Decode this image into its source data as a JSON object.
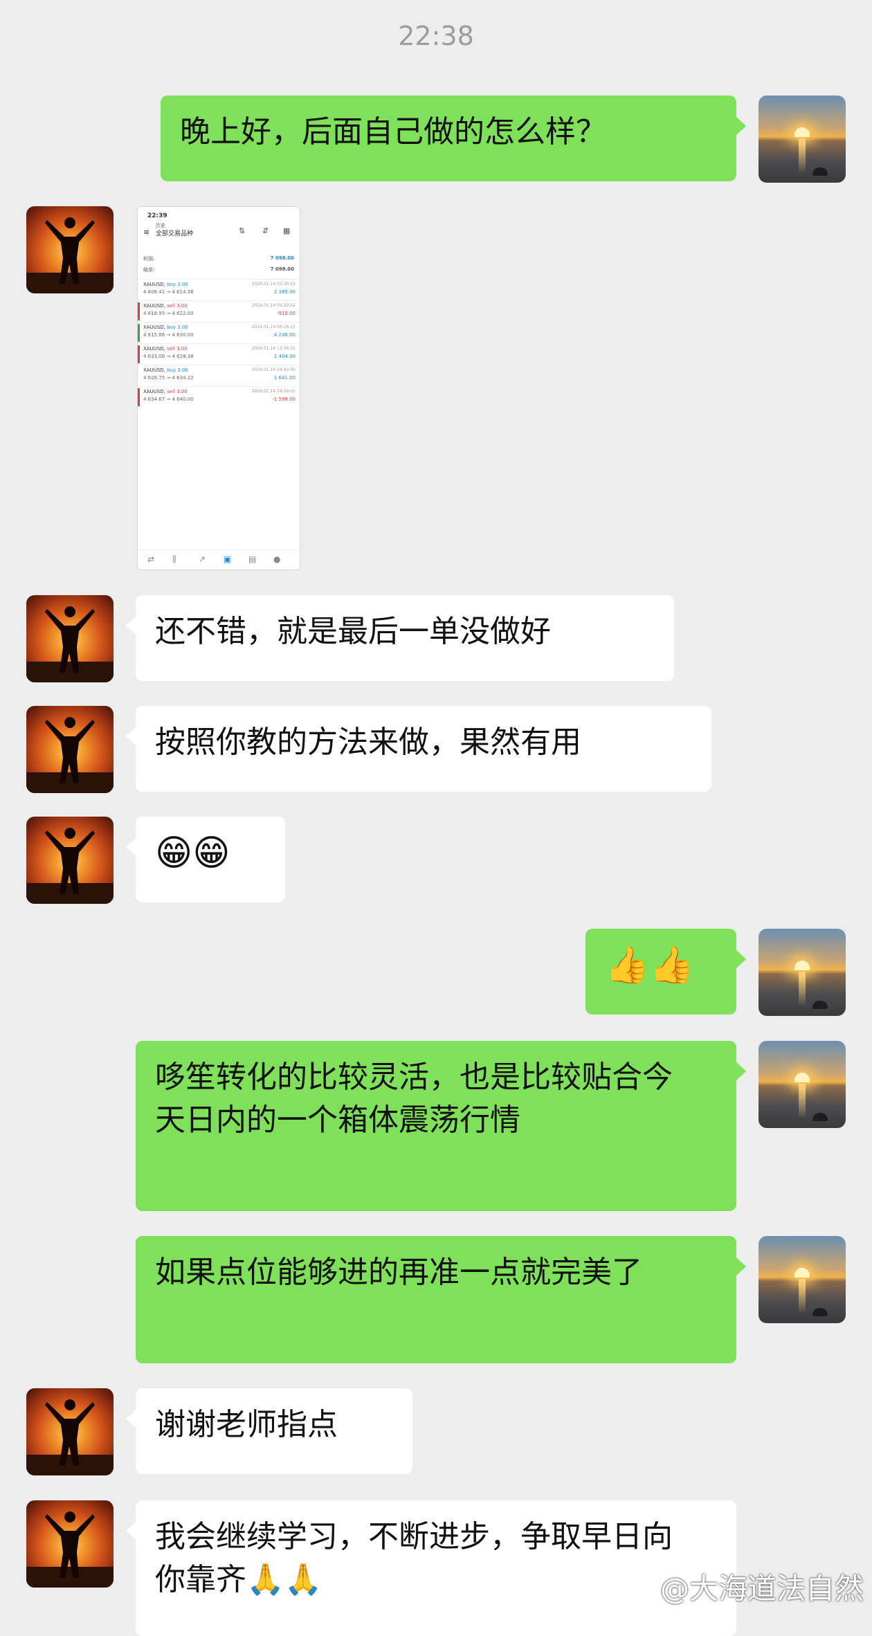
{
  "chat": {
    "time": "22:38",
    "messages": [
      {
        "from": "me",
        "text": "晚上好，后面自己做的怎么样？"
      },
      {
        "from": "friend",
        "type": "image"
      },
      {
        "from": "friend",
        "text": "还不错，就是最后一单没做好"
      },
      {
        "from": "friend",
        "text": "按照你教的方法来做，果然有用"
      },
      {
        "from": "friend",
        "text": "😁😁"
      },
      {
        "from": "me",
        "text": "👍👍"
      },
      {
        "from": "me",
        "text": "哆笙转化的比较灵活，也是比较贴合今天日内的一个箱体震荡行情"
      },
      {
        "from": "me",
        "text": "如果点位能够进的再准一点就完美了"
      },
      {
        "from": "friend",
        "text": "谢谢老师指点"
      },
      {
        "from": "friend",
        "text": "我会继续学习，不断进步，争取早日向你靠齐🙏🙏"
      }
    ]
  },
  "screenshot": {
    "status_time": "22:39",
    "header_small": "历史",
    "header_title": "全部交易品种",
    "profit_label": "利润:",
    "profit_value": "7 098.00",
    "balance_label": "结余:",
    "balance_value": "7 098.00",
    "trades": [
      {
        "symbol": "XAUUSD,",
        "side": "buy 3.00",
        "prices": "4 606.41 → 4 614.36",
        "datetime": "2026.01.14 03:30:51",
        "pl": "2 385.00",
        "dir": "buy"
      },
      {
        "symbol": "XAUUSD,",
        "side": "sell 3.00",
        "prices": "4 618.95 → 4 622.00",
        "datetime": "2026.01.14 05:20:52",
        "pl": "-915.00",
        "dir": "sell"
      },
      {
        "symbol": "XAUUSD,",
        "side": "buy 3.00",
        "prices": "4 615.88 → 4 630.00",
        "datetime": "2026.01.14 06:16:15",
        "pl": "4 236.00",
        "dir": "buy"
      },
      {
        "symbol": "XAUUSD,",
        "side": "sell 3.00",
        "prices": "4 633.06 → 4 628.38",
        "datetime": "2026.01.14 13:34:31",
        "pl": "1 404.00",
        "dir": "sell"
      },
      {
        "symbol": "XAUUSD,",
        "side": "buy 3.00",
        "prices": "4 628.75 → 4 634.22",
        "datetime": "2026.01.14 14:43:00",
        "pl": "1 641.00",
        "dir": "buy"
      },
      {
        "symbol": "XAUUSD,",
        "side": "sell 3.00",
        "prices": "4 634.67 → 4 640.00",
        "datetime": "2026.01.14 14:59:03",
        "pl": "-1 599.00",
        "dir": "sell"
      }
    ]
  },
  "watermark": "@大海道法自然",
  "colors": {
    "my_bubble": "#7fe05a",
    "friend_bubble": "#ffffff",
    "background": "#ededed"
  }
}
